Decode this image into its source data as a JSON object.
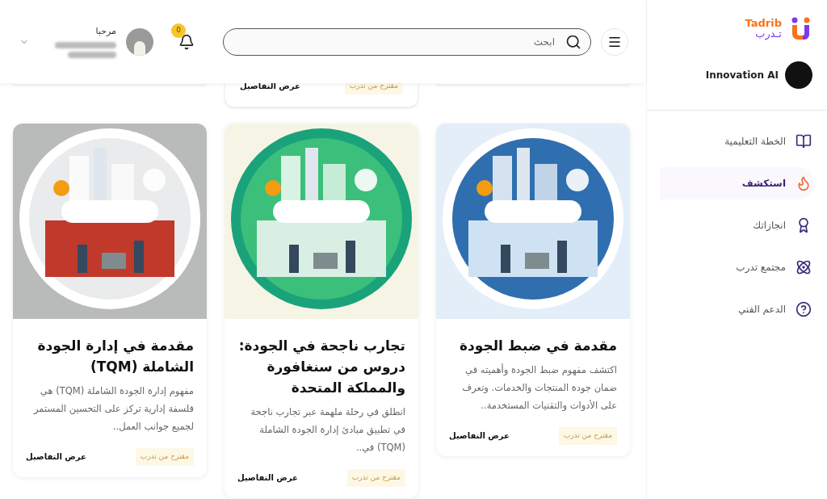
{
  "sidebar": {
    "logo": {
      "latin": "Tadrib",
      "arabic": "تـدرب"
    },
    "organization": "Innovation AI",
    "items": [
      {
        "label": "الخطة التعليمية",
        "selected": false
      },
      {
        "label": "استكشف",
        "selected": true
      },
      {
        "label": "انجازاتك",
        "selected": false
      },
      {
        "label": "مجتمع تدرب",
        "selected": false
      },
      {
        "label": "الدعم الفني",
        "selected": false
      }
    ]
  },
  "header": {
    "search": {
      "placeholder": "ابحث"
    },
    "notifications": "0",
    "greeting": "مرحبا"
  },
  "previous_row": [
    {
      "badge": "مقترح من تدرب",
      "link": "عرض التفاصيل"
    }
  ],
  "courses": [
    {
      "title": "مقدمة في ضبط الجودة",
      "description": "اكتشف مفهوم ضبط الجودة وأهميته في ضمان جودة المنتجات والخدمات. وتعرف على الأدوات والتقنيات المستخدمة..",
      "badge": "مقترح من تدرب",
      "link": "عرض التفاصيل",
      "kind": "picture"
    },
    {
      "title": "تجارب ناجحة في الجودة: دروس من سنغافورة والمملكة المتحدة",
      "description": "انطلق في رحلة ملهمة عبر تجارب ناجحة في تطبيق مبادئ إدارة الجودة الشاملة (TQM) في..",
      "badge": "مقترح من تدرب",
      "link": "عرض التفاصيل",
      "kind": "picture"
    },
    {
      "title": "مقدمة في إدارة الجودة الشاملة (TQM)",
      "description": "مفهوم إدارة الجودة الشاملة (TQM) هي فلسفة إدارية تركز على التحسين المستمر لجميع جوانب العمل..",
      "badge": "مقترح من تدرب",
      "link": "عرض التفاصيل",
      "kind": "picture"
    }
  ]
}
